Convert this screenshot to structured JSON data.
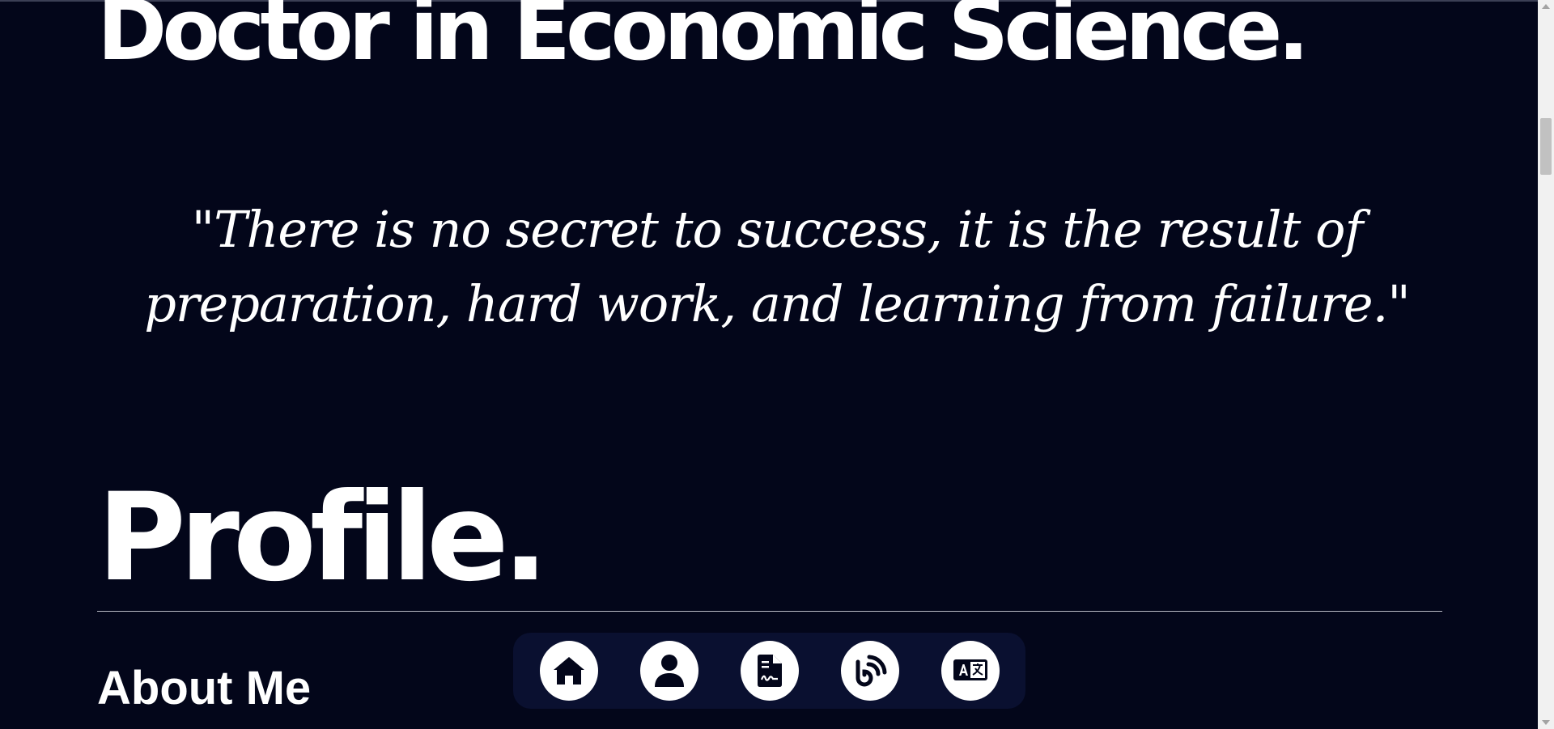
{
  "hero": {
    "headline": "Doctor in Economic Science."
  },
  "quote": {
    "text": "\"There is no secret to success, it is the result of preparation, hard work, and learning from failure.\""
  },
  "profile": {
    "title": "Profile.",
    "subtitle": "About Me"
  },
  "dock": {
    "items": [
      {
        "name": "home",
        "icon": "home-icon"
      },
      {
        "name": "profile",
        "icon": "user-icon"
      },
      {
        "name": "resume",
        "icon": "document-signature-icon"
      },
      {
        "name": "blog",
        "icon": "blog-icon"
      },
      {
        "name": "language",
        "icon": "translate-icon"
      }
    ]
  },
  "colors": {
    "background": "#03061a",
    "dock": "#0a1030",
    "text": "#ffffff"
  }
}
